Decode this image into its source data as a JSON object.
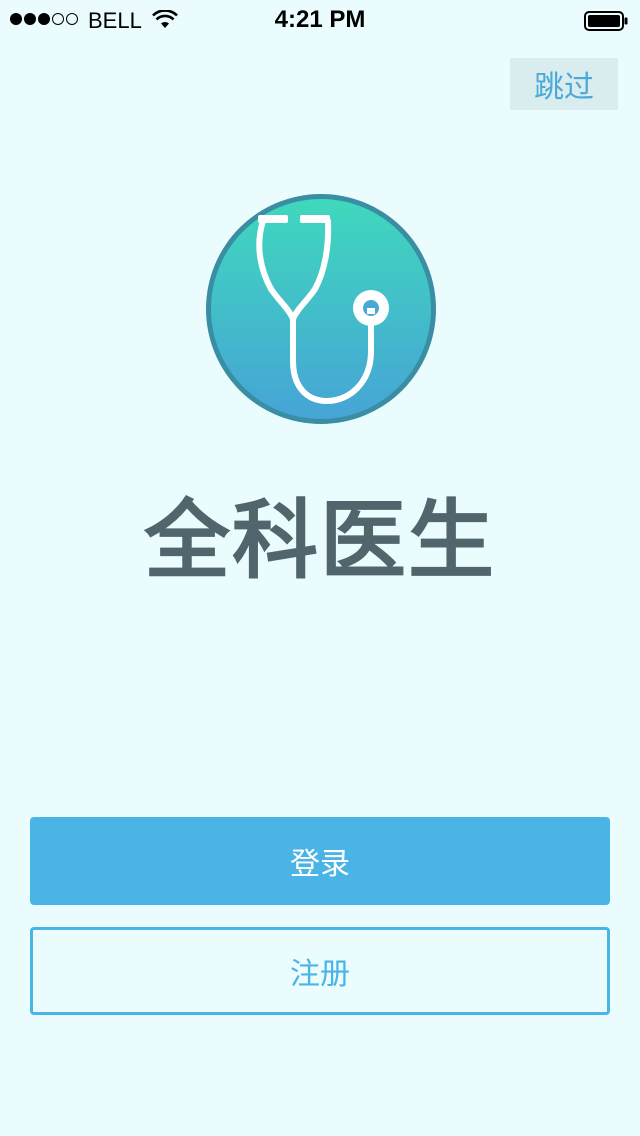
{
  "status_bar": {
    "carrier": "BELL",
    "time": "4:21 PM",
    "signal_filled": 3,
    "signal_total": 5,
    "battery_level": 1.0
  },
  "skip": {
    "label": "跳过"
  },
  "app": {
    "name": "全科医生",
    "logo_icon": "stethoscope-icon"
  },
  "actions": {
    "login_label": "登录",
    "register_label": "注册"
  },
  "colors": {
    "background": "#eafcfd",
    "accent": "#4ab4e6",
    "title": "#51666c",
    "logo_gradient_top": "#3fd8bd",
    "logo_gradient_bottom": "#46a4d6",
    "logo_ring": "#3a8ea4"
  }
}
